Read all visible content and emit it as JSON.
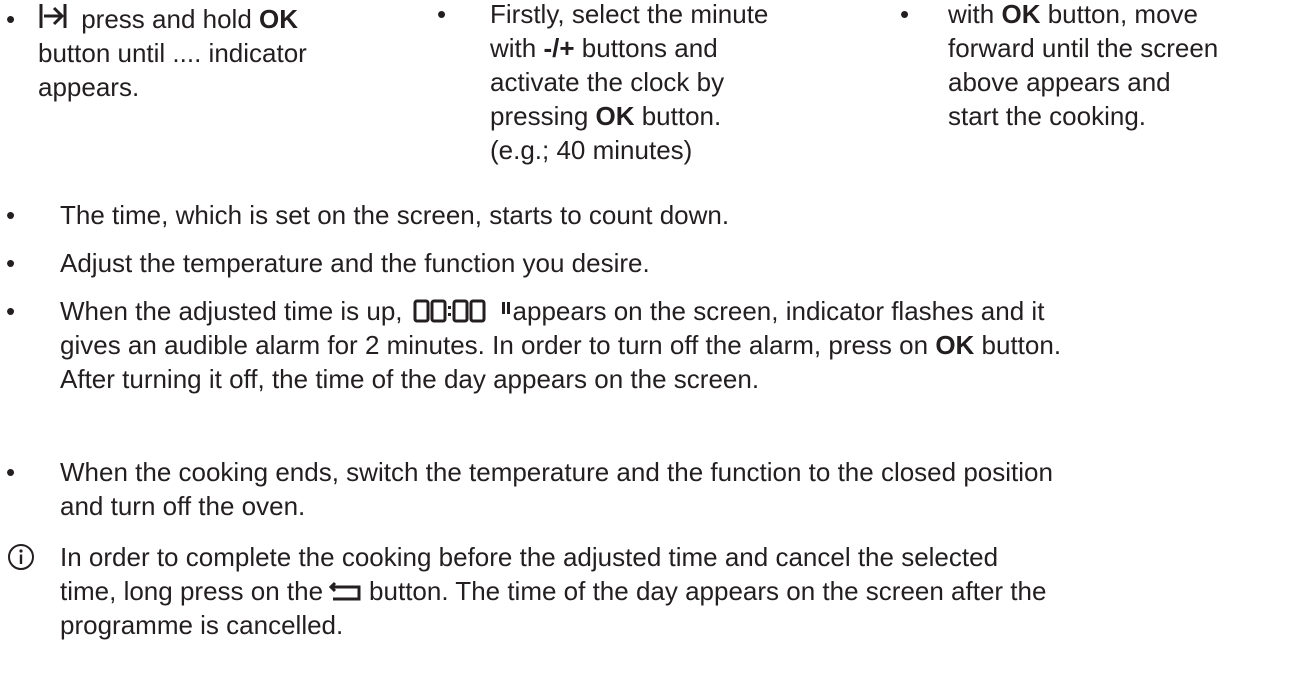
{
  "col1": {
    "bullet": "•",
    "l1_before": " press and hold ",
    "l1_bold": "OK",
    "l2": "button until .... indicator",
    "l3": "appears."
  },
  "col2": {
    "bullet": "•",
    "l1": "Firstly, select the minute",
    "l2_before": "with ",
    "l2_bold": "-/+",
    "l2_after": " buttons and",
    "l3": "activate the clock by",
    "l4_before": "pressing ",
    "l4_bold": "OK",
    "l4_after": " button.",
    "l5": "(e.g.; 40 minutes)"
  },
  "col3": {
    "bullet": "•",
    "l1_before": "with ",
    "l1_bold": "OK",
    "l1_after": " button, move",
    "l2": "forward until the screen",
    "l3": "above appears and",
    "l4": "start the cooking."
  },
  "item1": {
    "bullet": "•",
    "text": "The time, which is set on the screen, starts to count down."
  },
  "item2": {
    "bullet": "•",
    "text": "Adjust the temperature and the function you desire."
  },
  "item3": {
    "bullet": "•",
    "l1_before": "When the adjusted time is up,",
    "lcd": "00:00",
    "l1_after": "appears on the screen, indicator flashes and it",
    "l2_before": "gives an audible alarm for 2 minutes. In order to turn off the alarm, press on ",
    "l2_bold": "OK",
    "l2_after": " button.",
    "l3": "After turning it off, the time of the day appears on the screen."
  },
  "item4": {
    "bullet": "•",
    "l1": "When the cooking ends, switch the temperature and the function to the closed position",
    "l2": "and turn off the oven."
  },
  "info": {
    "l1": "In order to complete the cooking before the adjusted time and cancel the selected",
    "l2_before": "time, long press on the",
    "l2_after": "button. The time of the day appears on the screen after the",
    "l3": "programme is cancelled."
  },
  "icons": [
    "skip-forward-icon",
    "lcd-display-icon",
    "pause-indicator-icon",
    "back-arrow-icon",
    "info-icon"
  ]
}
